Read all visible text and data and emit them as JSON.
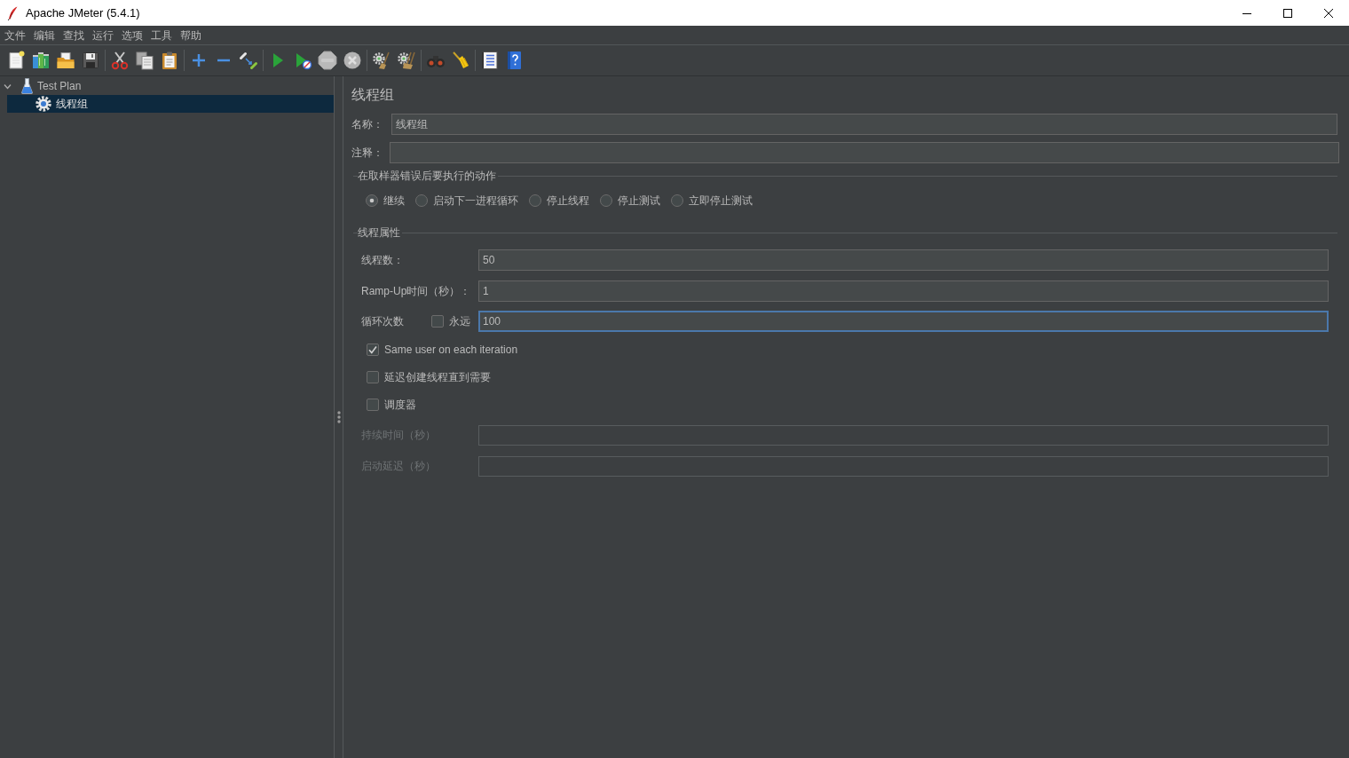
{
  "window": {
    "title": "Apache JMeter (5.4.1)"
  },
  "menu": [
    "文件",
    "编辑",
    "查找",
    "运行",
    "选项",
    "工具",
    "帮助"
  ],
  "tree": [
    {
      "label": "Test Plan",
      "kind": "testplan",
      "expanded": true,
      "selected": false,
      "children": [
        {
          "label": "线程组",
          "kind": "threadgroup",
          "selected": true
        }
      ]
    }
  ],
  "editor": {
    "title": "线程组",
    "name": {
      "label": "名称：",
      "value": "线程组"
    },
    "comment": {
      "label": "注释："
    },
    "on_error": {
      "legend": "在取样器错误后要执行的动作",
      "options": [
        {
          "label": "继续",
          "selected": true
        },
        {
          "label": "启动下一进程循环",
          "selected": false
        },
        {
          "label": "停止线程",
          "selected": false
        },
        {
          "label": "停止测试",
          "selected": false
        },
        {
          "label": "立即停止测试",
          "selected": false
        }
      ]
    },
    "thread_properties": {
      "legend": "线程属性",
      "thread_count": {
        "label": "线程数：",
        "value": "50"
      },
      "ramp_up": {
        "label": "Ramp-Up时间（秒）：",
        "value": "1"
      },
      "loop_count": {
        "label": "循环次数",
        "infinite": {
          "label": "永远",
          "checked": false
        },
        "value": "100",
        "focused": true
      },
      "options": [
        {
          "label": "Same user on each iteration",
          "checked": true
        },
        {
          "label": "延迟创建线程直到需要",
          "checked": false
        },
        {
          "label": "调度器",
          "checked": false
        }
      ],
      "duration": {
        "label": "持续时间（秒）",
        "disabled": true
      },
      "startup_delay": {
        "label": "启动延迟（秒）",
        "disabled": true
      }
    }
  }
}
